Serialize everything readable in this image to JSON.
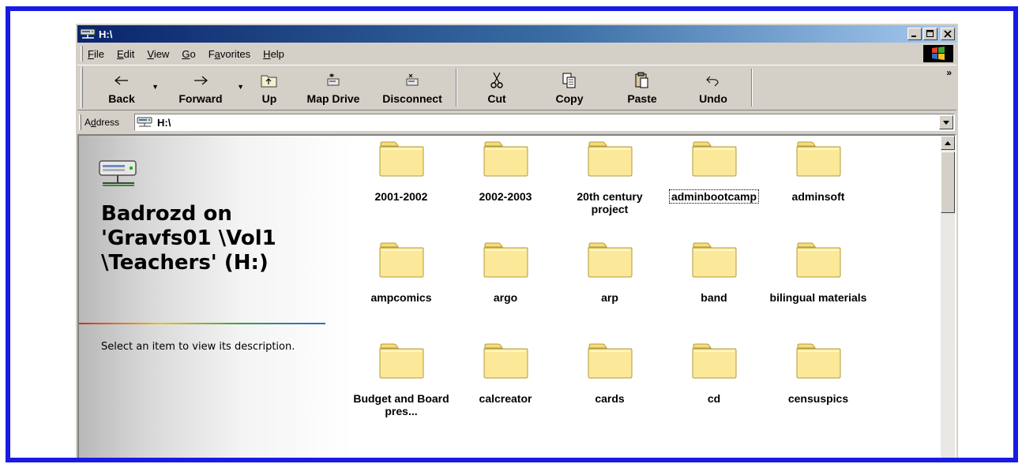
{
  "window": {
    "title": "H:\\",
    "controls": {
      "minimize": "_",
      "maximize": "□",
      "close": "×"
    }
  },
  "menu": {
    "items": [
      {
        "pre": "",
        "key": "F",
        "post": "ile"
      },
      {
        "pre": "",
        "key": "E",
        "post": "dit"
      },
      {
        "pre": "",
        "key": "V",
        "post": "iew"
      },
      {
        "pre": "",
        "key": "G",
        "post": "o"
      },
      {
        "pre": "F",
        "key": "a",
        "post": "vorites"
      },
      {
        "pre": "",
        "key": "H",
        "post": "elp"
      }
    ]
  },
  "toolbar": {
    "back": "Back",
    "forward": "Forward",
    "up": "Up",
    "map_drive": "Map Drive",
    "disconnect": "Disconnect",
    "cut": "Cut",
    "copy": "Copy",
    "paste": "Paste",
    "undo": "Undo",
    "more": "»"
  },
  "address": {
    "label_pre": "A",
    "label_key": "d",
    "label_post": "dress",
    "value": "H:\\"
  },
  "left_pane": {
    "title": "Badrozd on 'Gravfs01 \\Vol1 \\Teachers' (H:)",
    "description": "Select an item to view its description."
  },
  "folders": [
    {
      "label": "2001-2002"
    },
    {
      "label": "2002-2003"
    },
    {
      "label": "20th century project"
    },
    {
      "label": "adminbootcamp",
      "selected": true
    },
    {
      "label": "adminsoft"
    },
    {
      "label": "ampcomics"
    },
    {
      "label": "argo"
    },
    {
      "label": "arp"
    },
    {
      "label": "band"
    },
    {
      "label": "bilingual materials"
    },
    {
      "label": "Budget and Board pres..."
    },
    {
      "label": "calcreator"
    },
    {
      "label": "cards"
    },
    {
      "label": "cd"
    },
    {
      "label": "censuspics"
    }
  ],
  "colors": {
    "frame": "#1a1ae6",
    "title_start": "#0a246a",
    "title_end": "#a6caf0",
    "folder": "#fbe999"
  }
}
